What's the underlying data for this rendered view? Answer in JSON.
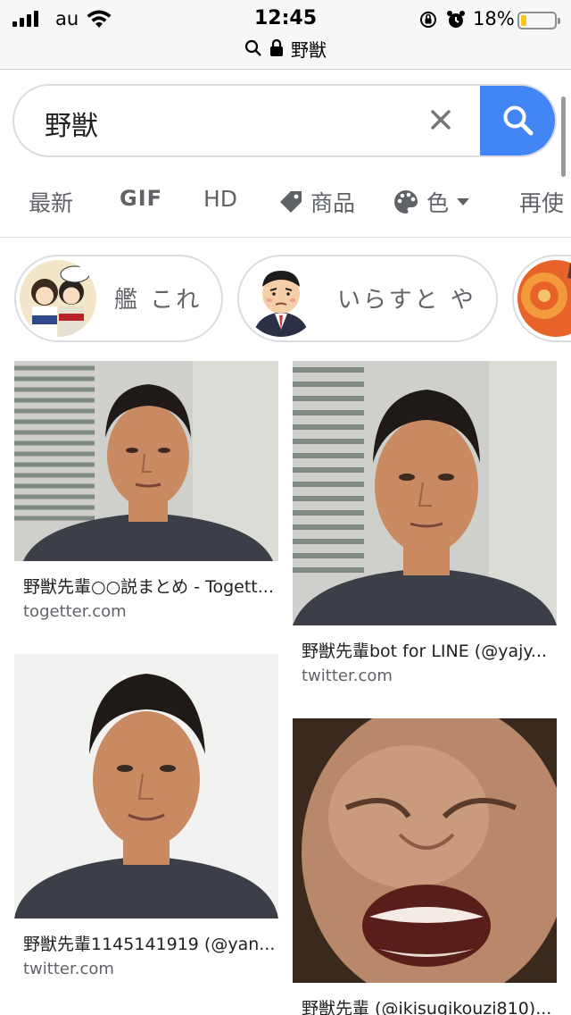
{
  "status_bar": {
    "carrier": "au",
    "time": "12:45",
    "battery_percent": "18%",
    "battery_level": 0.18,
    "battery_color": "#f5c518"
  },
  "browser": {
    "url": "野獣"
  },
  "search": {
    "query": "野獣",
    "accent": "#4285f4"
  },
  "tabs": [
    {
      "label": "最新"
    },
    {
      "label": "GIF"
    },
    {
      "label": "HD"
    },
    {
      "label": "商品",
      "icon": "tag-icon"
    },
    {
      "label": "色",
      "icon": "palette-icon"
    },
    {
      "label": "再使"
    }
  ],
  "chips": [
    {
      "label": "艦 これ"
    },
    {
      "label": "いらすと や"
    }
  ],
  "results": [
    {
      "title": "野獣先輩○○説まとめ - Togett...",
      "source": "togetter.com"
    },
    {
      "title": "野獣先輩bot for LINE (@yajy...",
      "source": "twitter.com"
    },
    {
      "title": "野獣先輩1145141919 (@yan...",
      "source": "twitter.com"
    },
    {
      "title": "野獣先輩 (@ikisugikouzi810)...",
      "source": ""
    }
  ]
}
